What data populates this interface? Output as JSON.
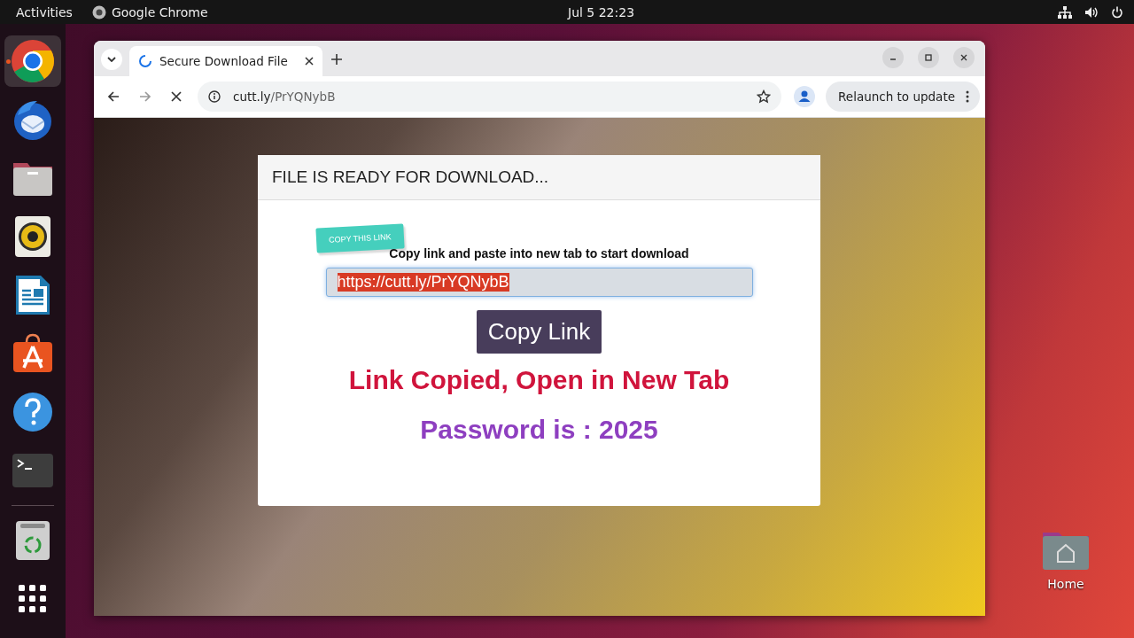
{
  "top_bar": {
    "activities": "Activities",
    "app_name": "Google Chrome",
    "clock": "Jul 5  22:23"
  },
  "dock": [
    {
      "kind": "chrome",
      "selected": true
    },
    {
      "kind": "mail"
    },
    {
      "kind": "files"
    },
    {
      "kind": "audio"
    },
    {
      "kind": "writer"
    },
    {
      "kind": "store"
    },
    {
      "kind": "help"
    },
    {
      "kind": "terminal"
    },
    {
      "kind": "separator"
    },
    {
      "kind": "trash"
    },
    {
      "kind": "apps"
    }
  ],
  "browser": {
    "tab": {
      "title": "Secure Download File",
      "loading": true
    },
    "address": {
      "host": "cutt.ly",
      "path": "/PrYQNybB"
    },
    "relaunch": "Relaunch to update"
  },
  "card": {
    "header": "FILE IS READY FOR DOWNLOAD...",
    "ribbon": "COPY THIS LINK",
    "instruction": "Copy link and paste into new tab to start download",
    "link": {
      "value": "https://cutt.ly/PrYQNybB",
      "selected": true
    },
    "button": "Copy Link",
    "status": "Link Copied, Open in New Tab",
    "password": "Password is : 2025"
  },
  "desktop_icons": [
    {
      "label": "Home"
    }
  ]
}
